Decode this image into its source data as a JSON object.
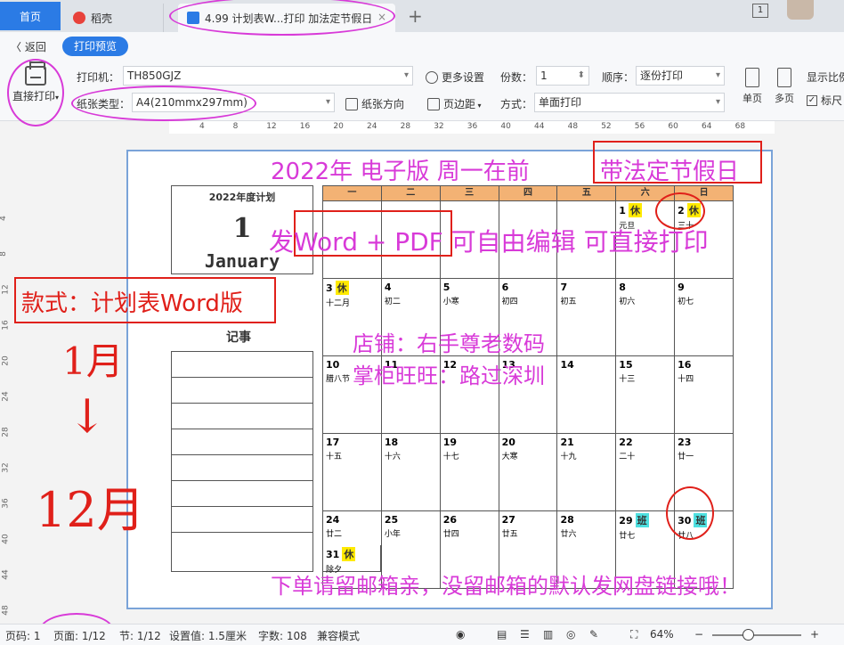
{
  "tabs": {
    "home": "首页",
    "daoke": "稻壳",
    "doc": "4.99 计划表W...打印 加法定节假日",
    "close": "×",
    "add": "+"
  },
  "window": {
    "pages": "1"
  },
  "toolbar": {
    "back": "〈 返回",
    "preview": "打印预览",
    "direct_print": "直接打印",
    "printer_label": "打印机：",
    "printer_value": "TH850GJZ",
    "more_settings": "更多设置",
    "copies_label": "份数：",
    "copies_value": "1",
    "order_label": "顺序：",
    "order_value": "逐份打印",
    "display_ratio": "显示比例",
    "paper_label": "纸张类型：",
    "paper_value": "A4(210mmx297mm)",
    "orientation": "纸张方向",
    "margin": "页边距",
    "mode_label": "方式：",
    "mode_value": "单面打印",
    "single_page": "单页",
    "multi_page": "多页",
    "ruler_toggle": "标尺"
  },
  "ruler": {
    "h_ticks": [
      "4",
      "8",
      "12",
      "16",
      "20",
      "24",
      "28",
      "32",
      "36",
      "40",
      "44",
      "48",
      "52",
      "56",
      "60",
      "64",
      "68"
    ],
    "v_ticks": [
      "4",
      "8",
      "12",
      "16",
      "20",
      "24",
      "28",
      "32",
      "36",
      "40",
      "44",
      "48"
    ]
  },
  "document": {
    "plan_title": "2022年度计划",
    "month_num": "1",
    "month_name": "January",
    "notes_title": "记事",
    "weekdays": [
      "一",
      "二",
      "三",
      "四",
      "五",
      "六",
      "日"
    ],
    "weeks": [
      [
        null,
        null,
        null,
        null,
        null,
        {
          "d": "1",
          "tag": "休",
          "tagType": "xiu",
          "lunar": "元旦"
        },
        {
          "d": "2",
          "tag": "休",
          "tagType": "xiu",
          "lunar": "三十"
        }
      ],
      [
        {
          "d": "3",
          "tag": "休",
          "tagType": "xiu",
          "lunar": "十二月"
        },
        {
          "d": "4",
          "lunar": "初二"
        },
        {
          "d": "5",
          "lunar": "小寒"
        },
        {
          "d": "6",
          "lunar": "初四"
        },
        {
          "d": "7",
          "lunar": "初五"
        },
        {
          "d": "8",
          "lunar": "初六"
        },
        {
          "d": "9",
          "lunar": "初七"
        }
      ],
      [
        {
          "d": "10",
          "lunar": "腊八节"
        },
        {
          "d": "11",
          "lunar": ""
        },
        {
          "d": "12",
          "lunar": ""
        },
        {
          "d": "13",
          "lunar": ""
        },
        {
          "d": "14",
          "lunar": ""
        },
        {
          "d": "15",
          "lunar": "十三"
        },
        {
          "d": "16",
          "lunar": "十四"
        }
      ],
      [
        {
          "d": "17",
          "lunar": "十五"
        },
        {
          "d": "18",
          "lunar": "十六"
        },
        {
          "d": "19",
          "lunar": "十七"
        },
        {
          "d": "20",
          "lunar": "大寒"
        },
        {
          "d": "21",
          "lunar": "十九"
        },
        {
          "d": "22",
          "lunar": "二十"
        },
        {
          "d": "23",
          "lunar": "廿一"
        }
      ],
      [
        {
          "d": "24",
          "lunar": "廿二"
        },
        {
          "d": "25",
          "lunar": "小年"
        },
        {
          "d": "26",
          "lunar": "廿四"
        },
        {
          "d": "27",
          "lunar": "廿五"
        },
        {
          "d": "28",
          "lunar": "廿六"
        },
        {
          "d": "29",
          "tag": "班",
          "tagType": "ban",
          "lunar": "廿七"
        },
        {
          "d": "30",
          "tag": "班",
          "tagType": "ban",
          "lunar": "廿八"
        }
      ]
    ],
    "extra": {
      "d": "31",
      "tag": "休",
      "tagType": "xiu",
      "lunar": "除夕"
    }
  },
  "promo": {
    "top": "2022年  电子版  周一在前",
    "holiday": "带法定节假日",
    "word_pdf": "发Word + PDF 可自由编辑 可直接打印",
    "style": "款式：计划表Word版",
    "shop": "店铺：右手尊老数码",
    "boss": "掌柜旺旺：路过深圳",
    "email": "下单请留邮箱亲，没留邮箱的默认发网盘链接哦！",
    "hand_start": "1月",
    "hand_arrow": "↓",
    "hand_end": "12月"
  },
  "statusbar": {
    "page_code": "页码: 1",
    "page": "页面: 1/12",
    "section": "节: 1/12",
    "setting": "设置值: 1.5厘米",
    "words": "字数: 108",
    "compat": "兼容模式",
    "zoom": "64%"
  },
  "colors": {
    "accent": "#2b7be5",
    "promo_magenta": "#d83ad8",
    "annotation_red": "#e0201a",
    "weekday_header": "#f3b274",
    "holiday_yellow": "#ffea00",
    "workday_cyan": "#4ee0e0"
  }
}
